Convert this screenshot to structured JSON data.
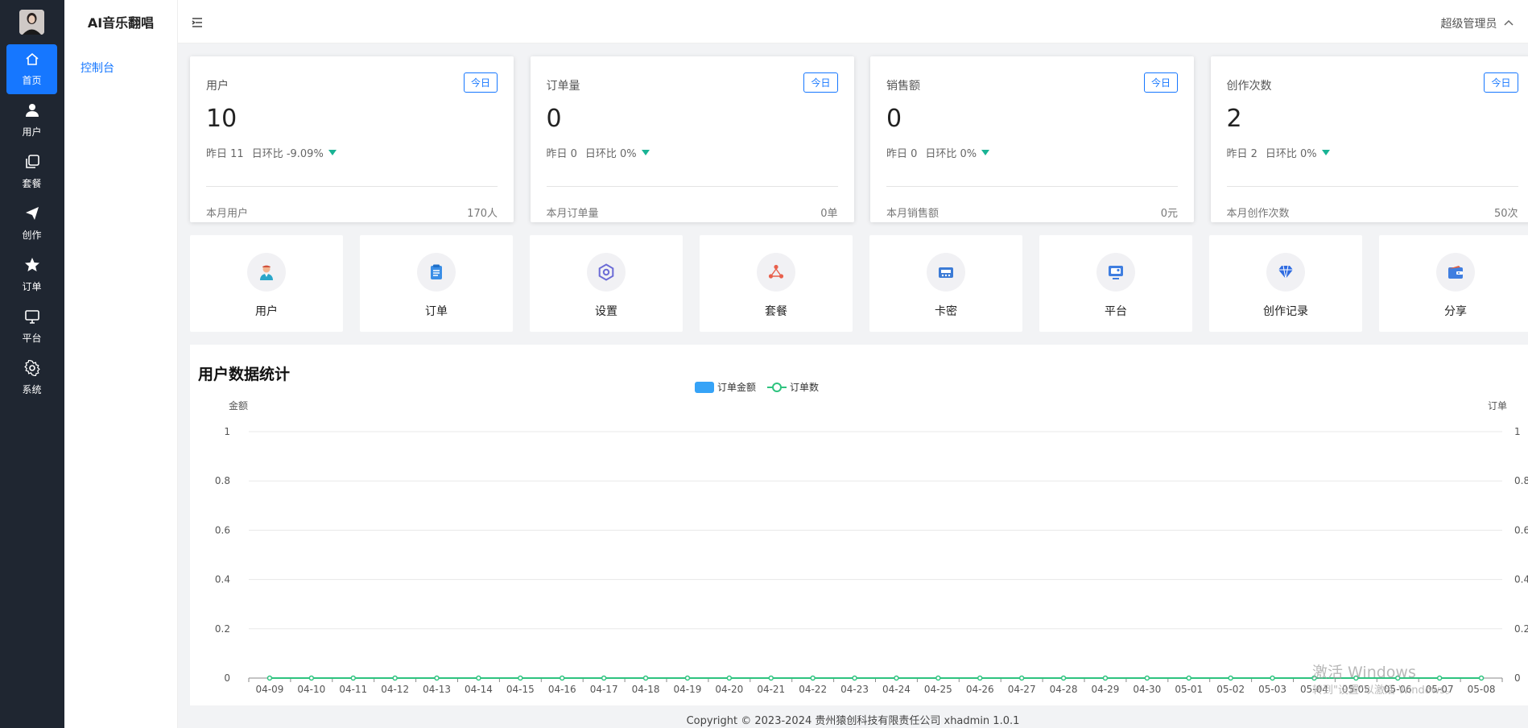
{
  "nav": {
    "items": [
      {
        "label": "首页",
        "icon": "home-icon",
        "active": true
      },
      {
        "label": "用户",
        "icon": "user-icon",
        "active": false
      },
      {
        "label": "套餐",
        "icon": "copy-icon",
        "active": false
      },
      {
        "label": "创作",
        "icon": "send-icon",
        "active": false
      },
      {
        "label": "订单",
        "icon": "star-icon",
        "active": false
      },
      {
        "label": "平台",
        "icon": "monitor-icon",
        "active": false
      },
      {
        "label": "系统",
        "icon": "gear-icon",
        "active": false
      }
    ]
  },
  "sidebar": {
    "title": "AI音乐翻唱",
    "items": [
      {
        "label": "控制台"
      }
    ]
  },
  "header": {
    "user": "超级管理员"
  },
  "stats": [
    {
      "title": "用户",
      "badge": "今日",
      "value": "10",
      "yesterday": "昨日 11",
      "ratio": "日环比 -9.09%",
      "month_label": "本月用户",
      "month_value": "170人"
    },
    {
      "title": "订单量",
      "badge": "今日",
      "value": "0",
      "yesterday": "昨日 0",
      "ratio": "日环比 0%",
      "month_label": "本月订单量",
      "month_value": "0单"
    },
    {
      "title": "销售额",
      "badge": "今日",
      "value": "0",
      "yesterday": "昨日 0",
      "ratio": "日环比 0%",
      "month_label": "本月销售额",
      "month_value": "0元"
    },
    {
      "title": "创作次数",
      "badge": "今日",
      "value": "2",
      "yesterday": "昨日 2",
      "ratio": "日环比 0%",
      "month_label": "本月创作次数",
      "month_value": "50次"
    }
  ],
  "quick": [
    {
      "label": "用户",
      "icon": "person-avatar-icon"
    },
    {
      "label": "订单",
      "icon": "clipboard-icon"
    },
    {
      "label": "设置",
      "icon": "hexagon-settings-icon"
    },
    {
      "label": "套餐",
      "icon": "package-icon"
    },
    {
      "label": "卡密",
      "icon": "card-icon"
    },
    {
      "label": "平台",
      "icon": "platform-icon"
    },
    {
      "label": "创作记录",
      "icon": "diamond-icon"
    },
    {
      "label": "分享",
      "icon": "wallet-icon"
    }
  ],
  "panel": {
    "title": "用户数据统计"
  },
  "chart_data": {
    "type": "bar",
    "legend": [
      "订单金额",
      "订单数"
    ],
    "legend_position": "top-center",
    "grid": true,
    "categories": [
      "04-09",
      "04-10",
      "04-11",
      "04-12",
      "04-13",
      "04-14",
      "04-15",
      "04-16",
      "04-17",
      "04-18",
      "04-19",
      "04-20",
      "04-21",
      "04-22",
      "04-23",
      "04-24",
      "04-25",
      "04-26",
      "04-27",
      "04-28",
      "04-29",
      "04-30",
      "05-01",
      "05-02",
      "05-03",
      "05-04",
      "05-05",
      "05-06",
      "05-07",
      "05-08"
    ],
    "series": [
      {
        "name": "订单金额",
        "type": "bar",
        "axis": "left",
        "color": "#36a3f7",
        "values": [
          0,
          0,
          0,
          0,
          0,
          0,
          0,
          0,
          0,
          0,
          0,
          0,
          0,
          0,
          0,
          0,
          0,
          0,
          0,
          0,
          0,
          0,
          0,
          0,
          0,
          0,
          0,
          0,
          0,
          0
        ]
      },
      {
        "name": "订单数",
        "type": "line",
        "axis": "right",
        "color": "#2ec37f",
        "values": [
          0,
          0,
          0,
          0,
          0,
          0,
          0,
          0,
          0,
          0,
          0,
          0,
          0,
          0,
          0,
          0,
          0,
          0,
          0,
          0,
          0,
          0,
          0,
          0,
          0,
          0,
          0,
          0,
          0,
          0
        ]
      }
    ],
    "ylabel_left": "金额",
    "ylabel_right": "订单",
    "yticks": [
      "0",
      "0.2",
      "0.4",
      "0.6",
      "0.8",
      "1"
    ],
    "ylim": [
      0,
      1
    ]
  },
  "footer": {
    "text": "Copyright © 2023-2024 贵州猿创科技有限责任公司   xhadmin 1.0.1"
  },
  "watermark": {
    "line1": "激活 Windows",
    "line2": "转到\"设置\"以激活 Windows。"
  },
  "colors": {
    "accent": "#1677ff",
    "rail": "#1f2631",
    "down": "#19b394"
  }
}
